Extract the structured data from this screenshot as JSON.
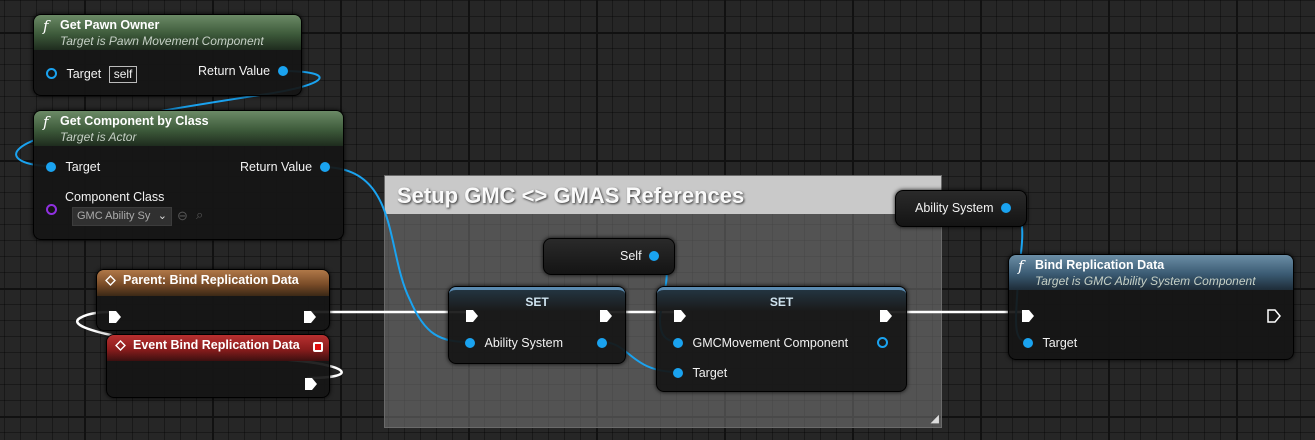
{
  "comment": {
    "title": "Setup GMC <> GMAS References",
    "resize_icon": "resize-grip-icon"
  },
  "nodes": {
    "get_pawn_owner": {
      "title": "Get Pawn Owner",
      "subtitle": "Target is Pawn Movement Component",
      "target_label": "Target",
      "target_value": "self",
      "return_label": "Return Value",
      "icon": "function-icon"
    },
    "get_component_by_class": {
      "title": "Get Component by Class",
      "subtitle": "Target is Actor",
      "target_label": "Target",
      "return_label": "Return Value",
      "component_class_label": "Component Class",
      "component_class_value": "GMC Ability Sy",
      "icon": "function-icon"
    },
    "parent_bind": {
      "title": "Parent: Bind Replication Data",
      "icon": "event-icon"
    },
    "event_bind": {
      "title": "Event Bind Replication Data",
      "icon": "event-icon"
    },
    "self_node": {
      "label": "Self"
    },
    "set_ability_system": {
      "title": "SET",
      "pin_label": "Ability System"
    },
    "set_gmc_movement": {
      "title": "SET",
      "pin_label": "GMCMovement Component",
      "target_label": "Target"
    },
    "ability_system_getter": {
      "label": "Ability System"
    },
    "bind_replication_data": {
      "title": "Bind Replication Data",
      "subtitle": "Target is GMC Ability System Component",
      "target_label": "Target",
      "icon": "function-icon"
    }
  },
  "colors": {
    "object_pin": "#1aa3f0",
    "class_pin": "#9030e0",
    "exec_wire": "#ffffff"
  }
}
